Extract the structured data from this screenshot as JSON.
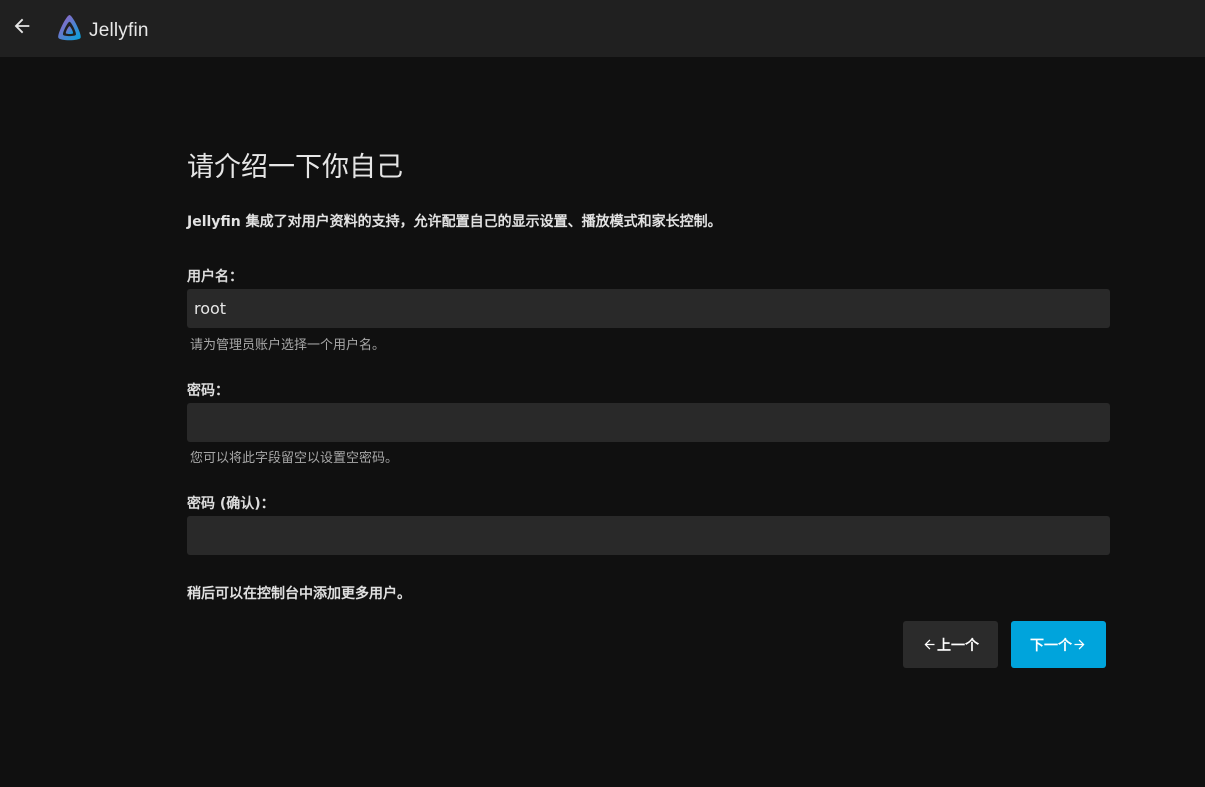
{
  "header": {
    "back_icon": "arrow-left-icon",
    "logo_icon": "jellyfin-logo-icon",
    "app_name": "Jellyfin"
  },
  "main": {
    "title": "请介绍一下你自己",
    "intro": "Jellyfin 集成了对用户资料的支持，允许配置自己的显示设置、播放模式和家长控制。",
    "username": {
      "label": "用户名：",
      "value": "root",
      "help": "请为管理员账户选择一个用户名。"
    },
    "password": {
      "label": "密码：",
      "value": "",
      "help": "您可以将此字段留空以设置空密码。"
    },
    "password_confirm": {
      "label": "密码 (确认)：",
      "value": ""
    },
    "note": "稍后可以在控制台中添加更多用户。",
    "prev_button": "上一个",
    "next_button": "下一个"
  },
  "colors": {
    "background": "#101010",
    "header": "#202020",
    "input": "#292929",
    "accent": "#00a4dc"
  }
}
